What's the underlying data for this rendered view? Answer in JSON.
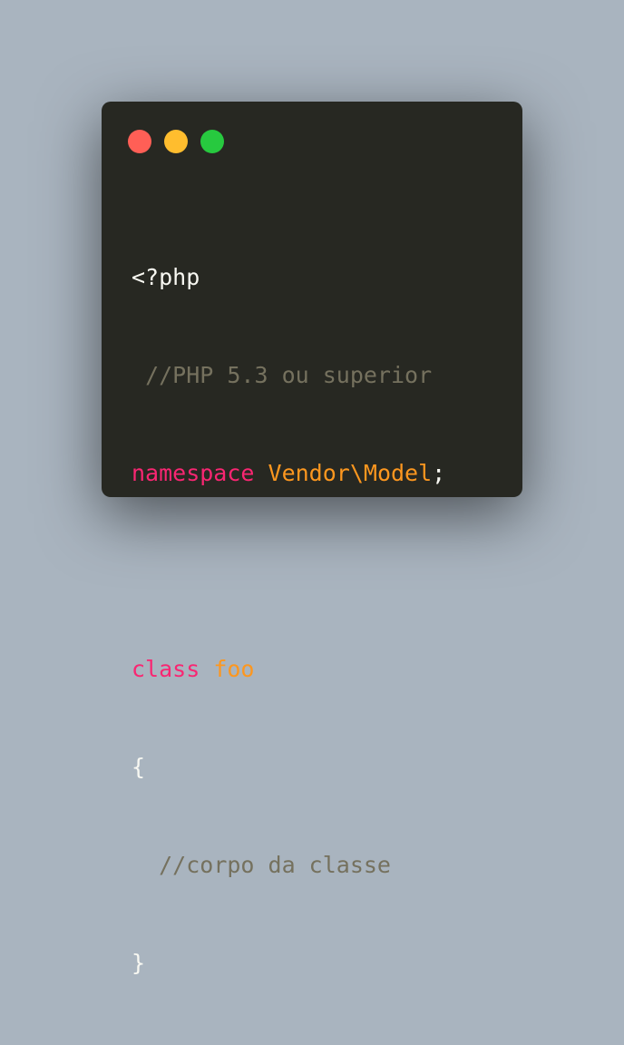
{
  "window": {
    "controls": {
      "close_color": "#ff5f56",
      "minimize_color": "#ffbd2e",
      "maximize_color": "#27c93f"
    }
  },
  "code": {
    "line1": {
      "open_tag": "<?php"
    },
    "line2": {
      "indent": " ",
      "comment": "//PHP 5.3 ou superior"
    },
    "line3": {
      "keyword": "namespace",
      "space": " ",
      "name": "Vendor\\Model",
      "terminator": ";"
    },
    "line5": {
      "keyword": "class",
      "space": " ",
      "name": "foo"
    },
    "line6": {
      "brace": "{"
    },
    "line7": {
      "indent": "  ",
      "comment": "//corpo da classe"
    },
    "line8": {
      "brace": "}"
    }
  },
  "theme": {
    "background": "#272822",
    "text": "#f8f8f2",
    "comment": "#75715e",
    "keyword": "#f92672",
    "name": "#fd971f"
  }
}
